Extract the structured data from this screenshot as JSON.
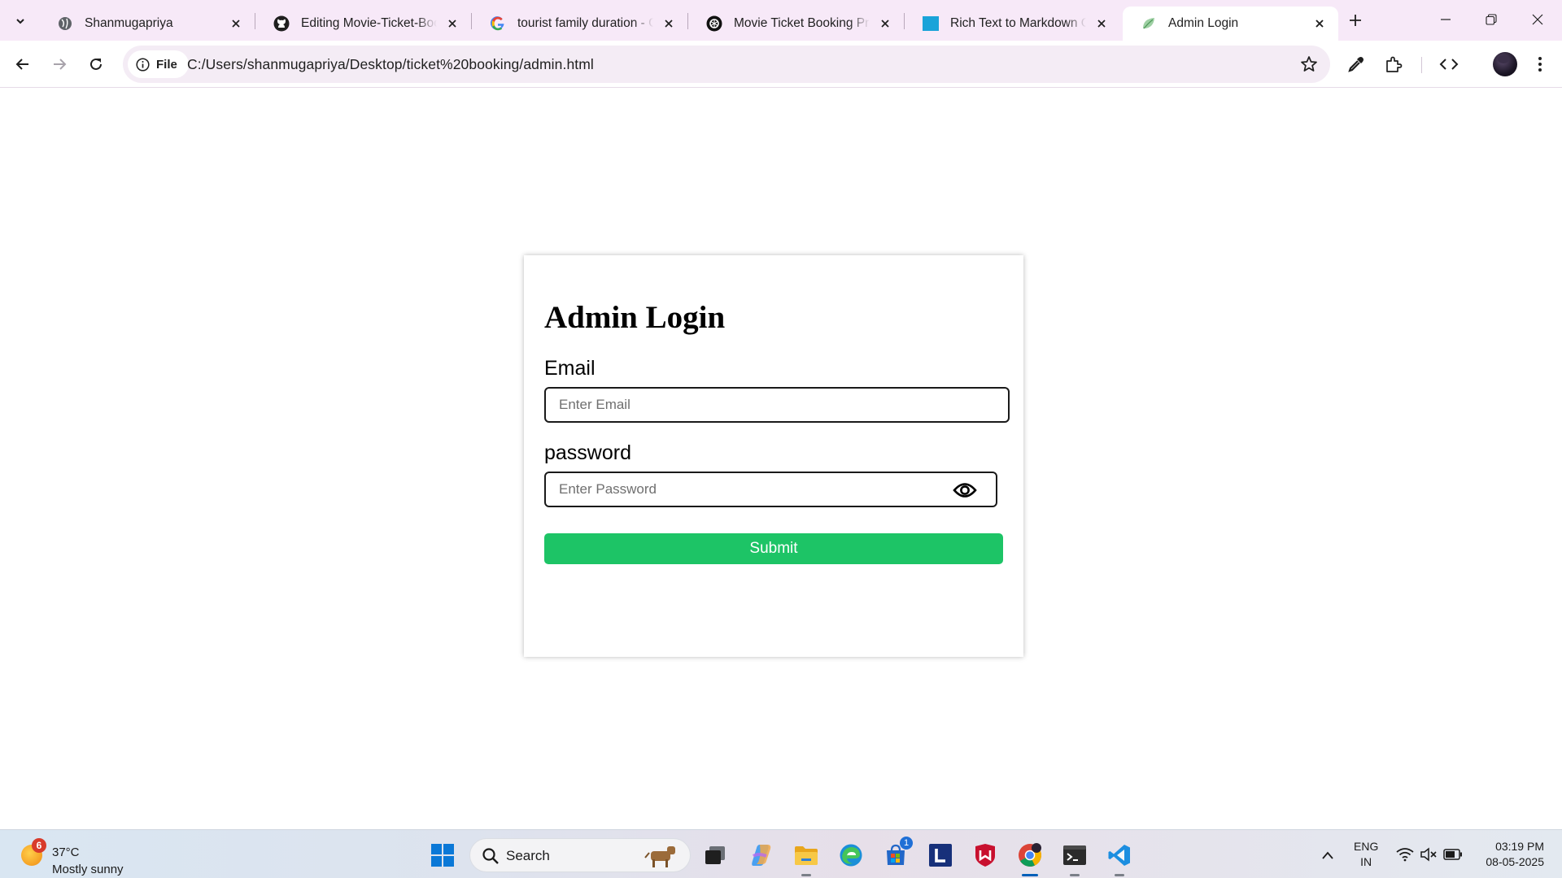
{
  "browser": {
    "tabs": [
      {
        "title": "Shanmugapriya",
        "favicon": "globe-icon",
        "active": false
      },
      {
        "title": "Editing Movie-Ticket-Booking",
        "favicon": "github-icon",
        "active": false
      },
      {
        "title": "tourist family duration - Google Search",
        "favicon": "google-icon",
        "active": false
      },
      {
        "title": "Movie Ticket Booking Project",
        "favicon": "chatgpt-icon",
        "active": false
      },
      {
        "title": "Rich Text to Markdown Converter",
        "favicon": "blue-square-icon",
        "active": false
      },
      {
        "title": "Admin Login",
        "favicon": "leaf-icon",
        "active": true
      }
    ],
    "address_bar": {
      "chip_label": "File",
      "url": "C:/Users/shanmugapriya/Desktop/ticket%20booking/admin.html"
    }
  },
  "page": {
    "heading": "Admin Login",
    "email": {
      "label": "Email",
      "placeholder": "Enter Email",
      "value": ""
    },
    "password": {
      "label": "password",
      "placeholder": "Enter Password",
      "value": ""
    },
    "submit_label": "Submit",
    "accent_color": "#1dc466"
  },
  "taskbar": {
    "weather": {
      "badge": "6",
      "temperature": "37°C",
      "condition": "Mostly sunny"
    },
    "search_label": "Search",
    "store_badge": "1",
    "language": {
      "line1": "ENG",
      "line2": "IN"
    },
    "clock": {
      "time": "03:19 PM",
      "date": "08-05-2025"
    }
  }
}
